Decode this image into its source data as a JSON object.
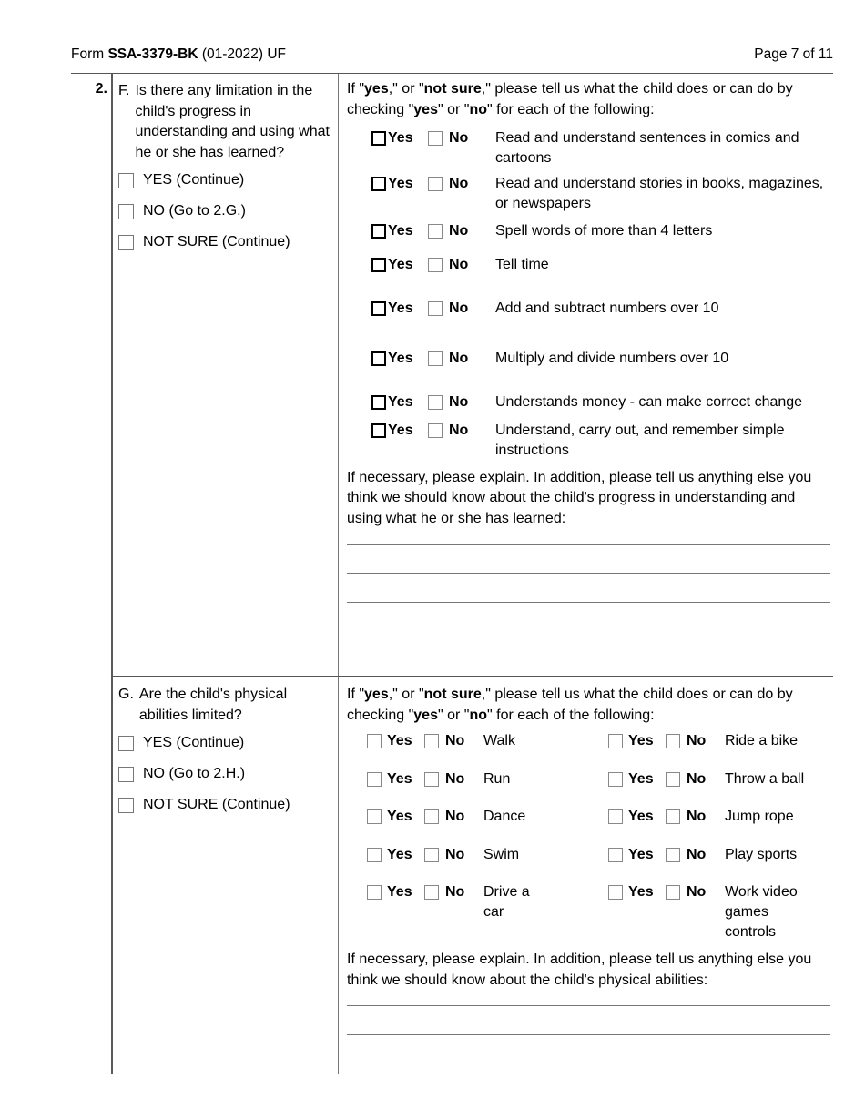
{
  "header": {
    "form_prefix": "Form ",
    "form_number": "SSA-3379-BK",
    "form_suffix": " (01-2022) UF",
    "page_label": "Page 7 of 11"
  },
  "item_number": "2.",
  "sections": [
    {
      "letter": "F.",
      "question": "Is there any limitation in the child's progress in understanding and using what he or she has learned?",
      "options": [
        {
          "label": "YES (Continue)"
        },
        {
          "label": "NO (Go to 2.G.)"
        },
        {
          "label": "NOT SURE (Continue)"
        }
      ],
      "intro": {
        "p1": "If \"",
        "b1": "yes",
        "p2": ",\" or \"",
        "b2": "not sure",
        "p3": ",\" please tell us what the child does or can do by checking \"",
        "b3": "yes",
        "p4": "\" or \"",
        "b4": "no",
        "p5": "\" for each of the following:"
      },
      "yes_label": "Yes",
      "no_label": "No",
      "items": [
        "Read and understand sentences in comics and cartoons",
        "Read and understand stories in books, magazines, or newspapers",
        "Spell words of more than 4 letters",
        "Tell time",
        "Add and subtract numbers over 10",
        "Multiply and divide numbers over 10",
        "Understands money - can make correct change",
        "Understand, carry out, and remember simple instructions"
      ],
      "explain": "If necessary, please explain. In addition, please tell us anything else you think we should know about the child's progress in understanding and using what he or she has learned:",
      "write_lines": 3
    },
    {
      "letter": "G.",
      "question": "Are the child's physical abilities limited?",
      "options": [
        {
          "label": "YES (Continue)"
        },
        {
          "label": "NO (Go to 2.H.)"
        },
        {
          "label": "NOT SURE (Continue)"
        }
      ],
      "intro": {
        "p1": "If \"",
        "b1": "yes",
        "p2": ",\" or \"",
        "b2": "not sure",
        "p3": ",\" please tell us what the child does or can do by checking \"",
        "b3": "yes",
        "p4": "\" or \"",
        "b4": "no",
        "p5": "\" for each of the following:"
      },
      "yes_label": "Yes",
      "no_label": "No",
      "grid_rows": [
        {
          "left": "Walk",
          "right": "Ride a bike"
        },
        {
          "left": "Run",
          "right": "Throw a ball"
        },
        {
          "left": "Dance",
          "right": "Jump rope"
        },
        {
          "left": "Swim",
          "right": "Play sports"
        },
        {
          "left": "Drive a car",
          "right": "Work video games controls"
        }
      ],
      "explain": "If necessary, please explain. In addition, please tell us anything else you think we should know about the child's physical abilities:",
      "write_lines": 3
    }
  ]
}
